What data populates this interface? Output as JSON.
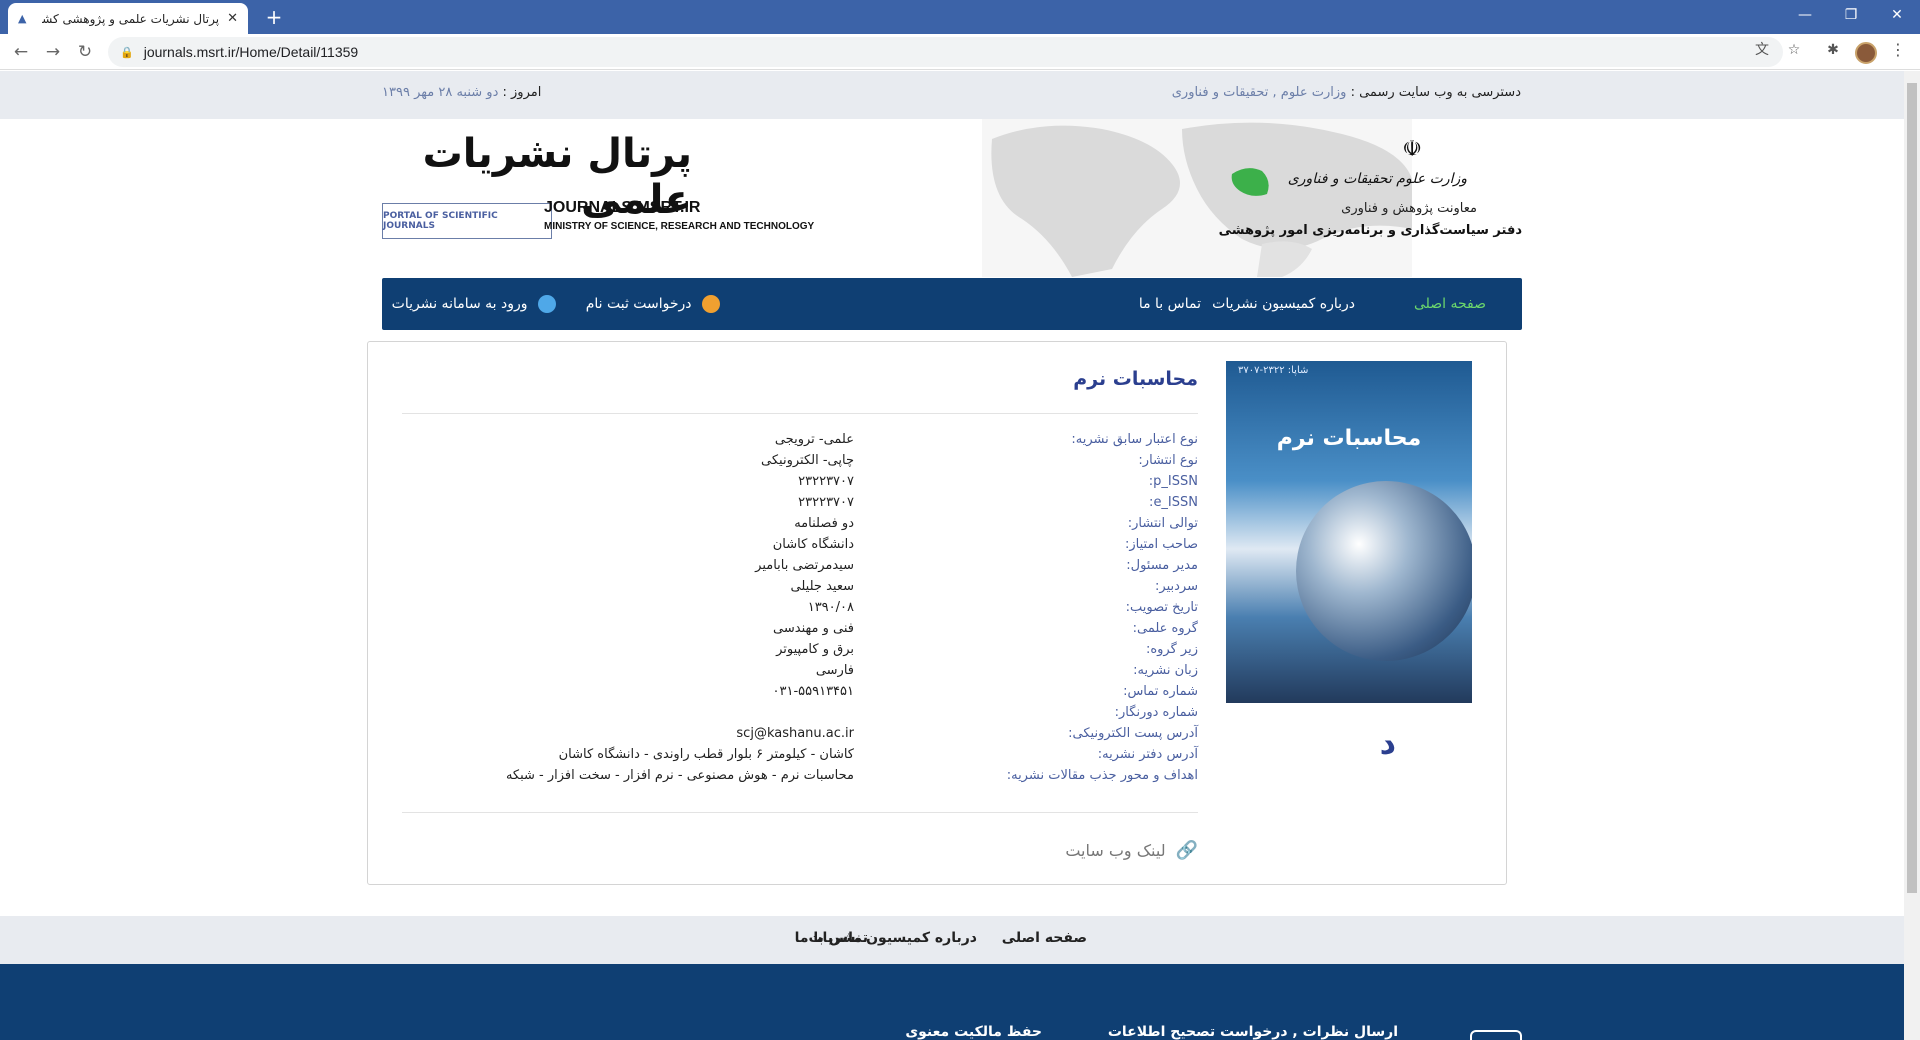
{
  "browser": {
    "tab_title": "پرتال نشریات علمی و پژوهشی کشو",
    "tab_close": "✕",
    "new_tab": "+",
    "url": "journals.msrt.ir/Home/Detail/11359"
  },
  "topbar": {
    "date_label": "امروز :",
    "date_value": "دو شنبه ۲۸ مهر ۱۳۹۹",
    "access_label": "دسترسی به وب سایت رسمی :",
    "access_link": "وزارت علوم , تحقیقات و فناوری"
  },
  "header": {
    "ministry_name": "وزارت علوم تحقیقات و فناوری",
    "deputy": "معاونت پژوهش و فناوری",
    "office": "دفتر سیاست‌گذاری و برنامه‌ریزی امور پژوهشی",
    "portal_title": "پرتال نشریات علمی",
    "portal_en": "PORTAL OF SCIENTIFIC JOURNALS",
    "journals_url": "JOURNALS.MSRT.IR",
    "ministry_en": "MINISTRY OF SCIENCE, RESEARCH AND TECHNOLOGY"
  },
  "nav": {
    "home": "صفحه اصلی",
    "about": "درباره کمیسیون نشریات",
    "contact": "تماس با ما",
    "register": "درخواست ثبت نام",
    "login": "ورود به سامانه نشریات"
  },
  "journal": {
    "title": "محاسبات نرم",
    "cover_title": "محاسبات نرم",
    "cover_issn": "شاپا: ۲۳۲۲-۳۷۰۷",
    "cover_letter": "د",
    "fields": [
      {
        "label": "نوع اعتبار سابق نشریه:",
        "value": "علمی- ترویجی"
      },
      {
        "label": "نوع انتشار:",
        "value": "چاپی- الکترونیکی"
      },
      {
        "label": "p_ISSN:",
        "value": "۲۳۲۲۳۷۰۷"
      },
      {
        "label": "e_ISSN:",
        "value": "۲۳۲۲۳۷۰۷"
      },
      {
        "label": "توالی انتشار:",
        "value": "دو فصلنامه"
      },
      {
        "label": "صاحب امتیاز:",
        "value": "دانشگاه کاشان"
      },
      {
        "label": "مدیر مسئول:",
        "value": "سیدمرتضی بابامیر"
      },
      {
        "label": "سردبیر:",
        "value": "سعید جلیلی"
      },
      {
        "label": "تاریخ تصویب:",
        "value": "۱۳۹۰/۰۸"
      },
      {
        "label": "گروه علمی:",
        "value": "فنی و مهندسی"
      },
      {
        "label": "زیر گروه:",
        "value": "برق و کامپیوتر"
      },
      {
        "label": "زبان نشریه:",
        "value": "فارسی"
      },
      {
        "label": "شماره تماس:",
        "value": "۰۳۱-۵۵۹۱۳۴۵۱"
      },
      {
        "label": "شماره دورنگار:",
        "value": ""
      },
      {
        "label": "آدرس پست الکترونیکی:",
        "value": "scj@kashanu.ac.ir"
      },
      {
        "label": "آدرس دفتر نشریه:",
        "value": "کاشان - کیلومتر ۶ بلوار قطب راوندی - دانشگاه کاشان"
      },
      {
        "label": "اهداف و محور جذب مقالات نشریه:",
        "value": "محاسبات نرم - هوش مصنوعی - نرم افزار - سخت افزار - شبکه"
      }
    ],
    "website_link": "لینک وب سایت"
  },
  "footer": {
    "home": "صفحه اصلی",
    "about": "درباره کمیسیون نشریات",
    "contact": "تماس با ما",
    "feedback": "ارسال نظرات , درخواست تصحیح اطلاعات",
    "ip": "حفظ مالکیت معنوی"
  },
  "colors": {
    "nav_bg": "#0f3f73",
    "active_nav": "#6cd86c",
    "label_blue": "#4a5fa0",
    "title_blue": "#2b3f8f"
  }
}
